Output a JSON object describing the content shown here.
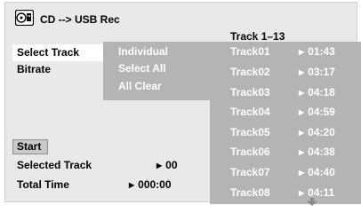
{
  "header": {
    "title": "CD --> USB Rec",
    "icon": "cd-to-usb-icon",
    "track_range": "Track  1–13"
  },
  "menu": {
    "items": [
      {
        "label": "Select Track",
        "selected": true
      },
      {
        "label": "Bitrate",
        "selected": false
      }
    ]
  },
  "submenu": {
    "items": [
      {
        "label": "Individual"
      },
      {
        "label": "Select All"
      },
      {
        "label": "All Clear"
      }
    ]
  },
  "tracks": [
    {
      "name": "Track01",
      "time": "01:43"
    },
    {
      "name": "Track02",
      "time": "03:17"
    },
    {
      "name": "Track03",
      "time": "04:18"
    },
    {
      "name": "Track04",
      "time": "04:59"
    },
    {
      "name": "Track05",
      "time": "04:20"
    },
    {
      "name": "Track06",
      "time": "04:38"
    },
    {
      "name": "Track07",
      "time": "04:40"
    },
    {
      "name": "Track08",
      "time": "04:11"
    }
  ],
  "start_button": {
    "label": "Start"
  },
  "selected_track": {
    "label": "Selected Track",
    "value": "00"
  },
  "total_time": {
    "label": "Total Time",
    "value": "000:00"
  },
  "colors": {
    "panel_bg": "#e9e9e9",
    "list_bg": "#b4b4b4",
    "list_text": "#ffffff",
    "highlight": "#ffffff"
  }
}
